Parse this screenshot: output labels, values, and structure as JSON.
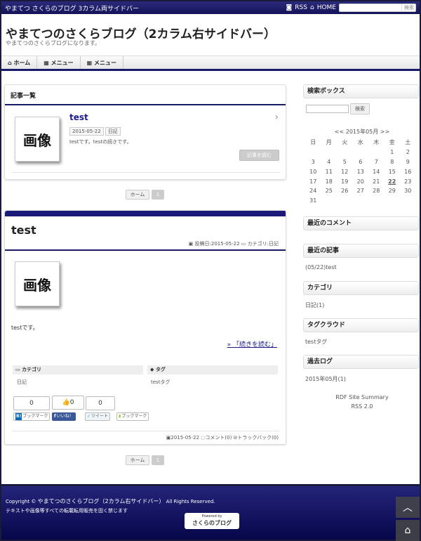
{
  "topbar": {
    "subtitle": "やまてつ さくらのブログ 3カラム両サイドバー",
    "rss": "RSS",
    "home": "HOME",
    "search_btn": "検索"
  },
  "header": {
    "title": "やまてつのさくらブログ（2カラム右サイドバー）",
    "description": "やまてつのさくらブログになります。"
  },
  "nav": [
    {
      "icon": "home-icon",
      "label": "ホーム"
    },
    {
      "icon": "grid-icon",
      "label": "メニュー"
    },
    {
      "icon": "grid-icon",
      "label": "メニュー"
    }
  ],
  "list": {
    "heading": "記事一覧",
    "image_text": "画像",
    "post_title": "test",
    "date": "2015-05-22",
    "category": "日記",
    "excerpt": "testです。testの続きです。",
    "read_more": "記事を読む"
  },
  "pager": {
    "home": "ホーム",
    "page": "1"
  },
  "article": {
    "title": "test",
    "posted": "投稿日:2015-05-22",
    "category_meta": "カテゴリ:日記",
    "image_text": "画像",
    "body": "testです。",
    "continue": "» 「続きを読む」",
    "cat_header": "カテゴリ",
    "cat_value": "日記",
    "tag_header": "タグ",
    "tag_value": "testタグ",
    "counts": [
      "0",
      "0",
      "0"
    ],
    "like_count": "0",
    "hatena": "ブックマーク",
    "fb": "いいね！",
    "tw": "ツイート",
    "pocket": "ブックマーク",
    "foot_date": "2015-05-22",
    "comments": "コメント(0)",
    "trackbacks": "トラックバック(0)"
  },
  "sidebar": {
    "search_title": "検索ボックス",
    "search_btn": "検索",
    "cal_title": "<< 2015年05月 >>",
    "weekdays": [
      "日",
      "月",
      "火",
      "水",
      "木",
      "金",
      "土"
    ],
    "weeks": [
      [
        "",
        "",
        "",
        "",
        "",
        "1",
        "2"
      ],
      [
        "3",
        "4",
        "5",
        "6",
        "7",
        "8",
        "9"
      ],
      [
        "10",
        "11",
        "12",
        "13",
        "14",
        "15",
        "16"
      ],
      [
        "17",
        "18",
        "19",
        "20",
        "21",
        "22",
        "23"
      ],
      [
        "24",
        "25",
        "26",
        "27",
        "28",
        "29",
        "30"
      ],
      [
        "31",
        "",
        "",
        "",
        "",
        "",
        ""
      ]
    ],
    "recent_comments": "最近のコメント",
    "recent_posts": "最近の記事",
    "recent_post_item": "(05/22)test",
    "categories": "カテゴリ",
    "category_item": "日記(1)",
    "tag_cloud": "タグクラウド",
    "tag_item": "testタグ",
    "archive": "過去ログ",
    "archive_item": "2015年05月(1)",
    "rdf": "RDF Site Summary",
    "rss2": "RSS 2.0"
  },
  "footer": {
    "copyright_prefix": "Copyright ©",
    "site": "やまてつのさくらブログ（2カラム右サイドバー）",
    "rights": "All Rights Reserved.",
    "notice": "テキストや画像等すべての転載転用販売を固く禁じます",
    "powered": "Powered by",
    "logo": "さくらのブログ"
  },
  "colors": {
    "accent": "#1a1a6a",
    "footer": "#14145a"
  }
}
